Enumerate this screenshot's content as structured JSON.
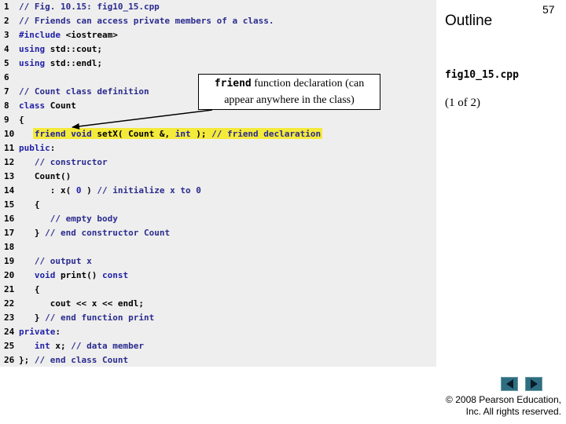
{
  "code_lines": [
    {
      "n": "1",
      "html": "<span class=\"tok-cm\">// Fig. 10.15: fig10_15.cpp</span>"
    },
    {
      "n": "2",
      "html": "<span class=\"tok-cm\">// Friends can access private members of a class.</span>"
    },
    {
      "n": "3",
      "html": "<span class=\"tok-pp\">#include</span> &lt;iostream&gt;"
    },
    {
      "n": "4",
      "html": "<span class=\"tok-kw\">using</span> std::cout;"
    },
    {
      "n": "5",
      "html": "<span class=\"tok-kw\">using</span> std::endl;"
    },
    {
      "n": "6",
      "html": ""
    },
    {
      "n": "7",
      "html": "<span class=\"tok-cm\">// Count class definition</span>"
    },
    {
      "n": "8",
      "html": "<span class=\"tok-kw\">class</span> Count"
    },
    {
      "n": "9",
      "html": "{"
    },
    {
      "n": "10",
      "html": "   <span class=\"tok-kw\">friend void</span> setX( Count &amp;, <span class=\"tok-kw\">int</span> ); <span class=\"tok-cm\">// friend declaration</span>"
    },
    {
      "n": "11",
      "html": "<span class=\"tok-kw\">public</span>:"
    },
    {
      "n": "12",
      "html": "   <span class=\"tok-cm\">// constructor</span>"
    },
    {
      "n": "13",
      "html": "   Count()"
    },
    {
      "n": "14",
      "html": "      : x( <span class=\"tok-num\">0</span> ) <span class=\"tok-cm\">// initialize x to 0</span>"
    },
    {
      "n": "15",
      "html": "   {"
    },
    {
      "n": "16",
      "html": "      <span class=\"tok-cm\">// empty body</span>"
    },
    {
      "n": "17",
      "html": "   } <span class=\"tok-cm\">// end constructor Count</span>"
    },
    {
      "n": "18",
      "html": ""
    },
    {
      "n": "19",
      "html": "   <span class=\"tok-cm\">// output x</span>"
    },
    {
      "n": "20",
      "html": "   <span class=\"tok-kw\">void</span> print() <span class=\"tok-kw\">const</span>"
    },
    {
      "n": "21",
      "html": "   {"
    },
    {
      "n": "22",
      "html": "      cout &lt;&lt; x &lt;&lt; endl;"
    },
    {
      "n": "23",
      "html": "   } <span class=\"tok-cm\">// end function print</span>"
    },
    {
      "n": "24",
      "html": "<span class=\"tok-kw\">private</span>:"
    },
    {
      "n": "25",
      "html": "   <span class=\"tok-kw\">int</span> x; <span class=\"tok-cm\">// data member</span>"
    },
    {
      "n": "26",
      "html": "}; <span class=\"tok-cm\">// end class Count</span>"
    }
  ],
  "callout": {
    "keyword": "friend",
    "text_after_keyword": " function declaration (can",
    "line2": "appear anywhere in the class)"
  },
  "sidebar": {
    "outline": "Outline",
    "page_number": "57",
    "filename": "fig10_15.cpp",
    "page_of": "(1 of 2)"
  },
  "nav": {
    "prev_icon": "triangle-left-icon",
    "next_icon": "triangle-right-icon"
  },
  "copyright": {
    "line1": "© 2008 Pearson Education,",
    "line2": "Inc.  All rights reserved."
  },
  "colors": {
    "highlight": "#f4ea3a",
    "code_panel_bg": "#eeeeee",
    "keyword": "#1f1fa8",
    "nav_button": "#2e6e80"
  }
}
